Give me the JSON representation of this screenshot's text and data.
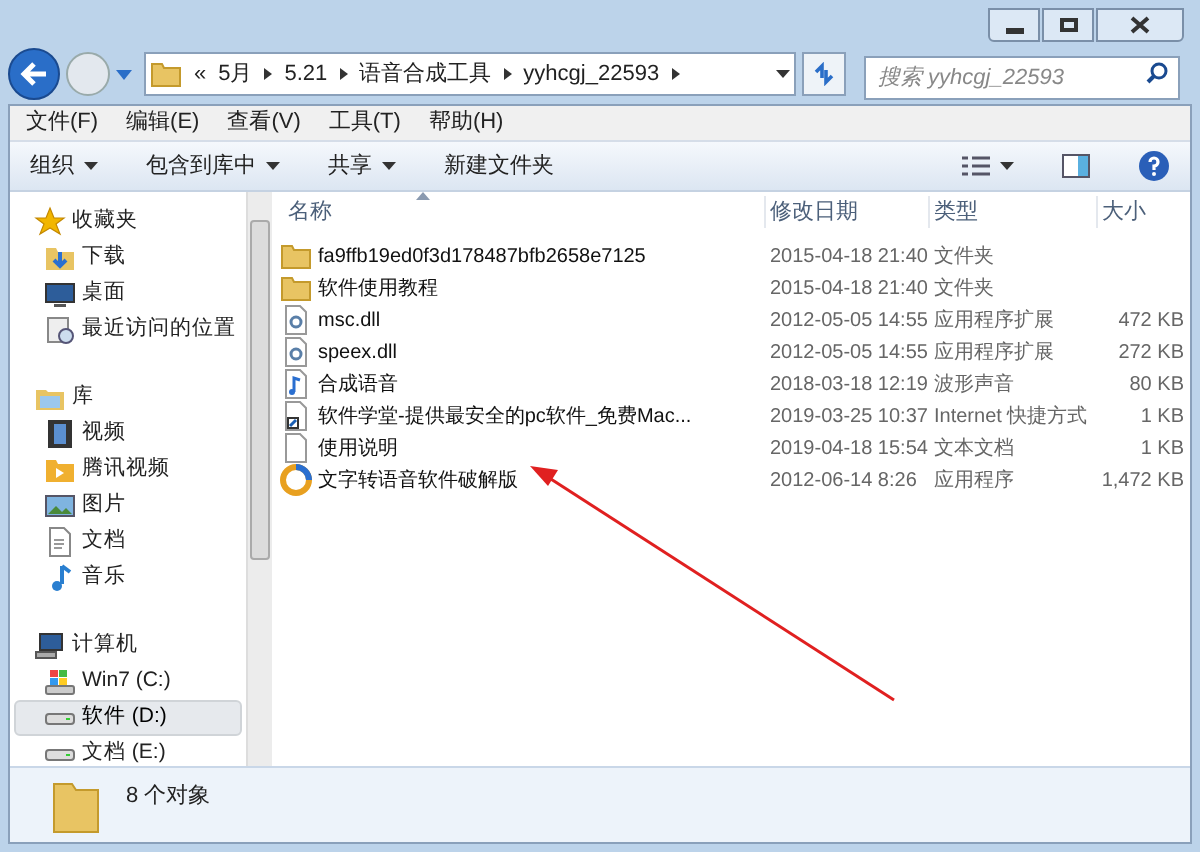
{
  "address": {
    "segments": [
      "«",
      "5月",
      "5.21",
      "语音合成工具",
      "yyhcgj_22593"
    ]
  },
  "search": {
    "placeholder": "搜索 yyhcgj_22593"
  },
  "menu": [
    "文件(F)",
    "编辑(E)",
    "查看(V)",
    "工具(T)",
    "帮助(H)"
  ],
  "toolbar": [
    {
      "label": "组织",
      "dropdown": true
    },
    {
      "label": "包含到库中",
      "dropdown": true
    },
    {
      "label": "共享",
      "dropdown": true
    },
    {
      "label": "新建文件夹",
      "dropdown": false
    }
  ],
  "nav": [
    {
      "label": "收藏夹",
      "kind": "star",
      "selected": false,
      "children": [
        {
          "label": "下载",
          "kind": "download",
          "selected": false
        },
        {
          "label": "桌面",
          "kind": "desktop",
          "selected": false
        },
        {
          "label": "最近访问的位置",
          "kind": "recent",
          "selected": false
        }
      ]
    },
    {
      "label": "库",
      "kind": "library",
      "selected": false,
      "children": [
        {
          "label": "视频",
          "kind": "video",
          "selected": false
        },
        {
          "label": "腾讯视频",
          "kind": "tencent",
          "selected": false
        },
        {
          "label": "图片",
          "kind": "picture",
          "selected": false
        },
        {
          "label": "文档",
          "kind": "doc",
          "selected": false
        },
        {
          "label": "音乐",
          "kind": "music",
          "selected": false
        }
      ]
    },
    {
      "label": "计算机",
      "kind": "computer",
      "selected": false,
      "children": [
        {
          "label": "Win7 (C:)",
          "kind": "windrive",
          "selected": false
        },
        {
          "label": "软件 (D:)",
          "kind": "drive",
          "selected": true
        },
        {
          "label": "文档 (E:)",
          "kind": "drive",
          "selected": false
        }
      ]
    }
  ],
  "columns": [
    "名称",
    "修改日期",
    "类型",
    "大小"
  ],
  "files": [
    {
      "name": "fa9ffb19ed0f3d178487bfb2658e7125",
      "kind": "folder",
      "date": "2015-04-18 21:40",
      "type": "文件夹"
    },
    {
      "name": "软件使用教程",
      "kind": "folder",
      "date": "2015-04-18 21:40",
      "type": "文件夹"
    },
    {
      "name": "msc.dll",
      "kind": "dll",
      "date": "2012-05-05 14:55",
      "type": "应用程序扩展",
      "size": "472 KB"
    },
    {
      "name": "speex.dll",
      "kind": "dll",
      "date": "2012-05-05 14:55",
      "type": "应用程序扩展",
      "size": "272 KB"
    },
    {
      "name": "合成语音",
      "kind": "audio",
      "date": "2018-03-18 12:19",
      "type": "波形声音",
      "size": "80 KB"
    },
    {
      "name": "软件学堂-提供最安全的pc软件_免费Mac...",
      "kind": "shortcut",
      "date": "2019-03-25 10:37",
      "type": "Internet 快捷方式",
      "size": "1 KB"
    },
    {
      "name": "使用说明",
      "kind": "text",
      "date": "2019-04-18 15:54",
      "type": "文本文档",
      "size": "1 KB"
    },
    {
      "name": "文字转语音软件破解版",
      "kind": "app",
      "date": "2012-06-14 8:26",
      "type": "应用程序",
      "size": "1,472 KB"
    }
  ],
  "status": "8 个对象"
}
